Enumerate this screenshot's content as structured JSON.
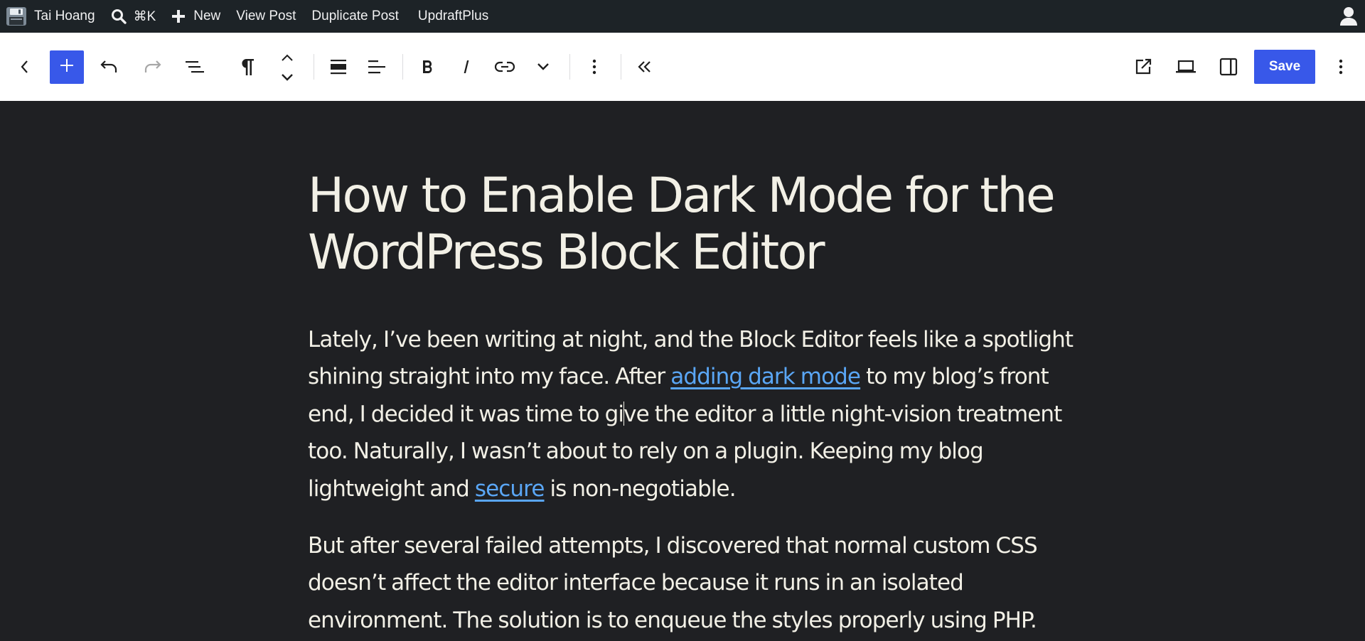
{
  "admin_bar": {
    "site_name": "Tai Hoang",
    "search_shortcut": "⌘K",
    "new_label": "New",
    "view_post": "View Post",
    "duplicate_post": "Duplicate Post",
    "updraftplus": "UpdraftPlus"
  },
  "toolbar": {
    "save_label": "Save",
    "icons": [
      "back-icon",
      "add-block-icon",
      "undo-icon",
      "redo-icon",
      "document-overview-icon",
      "paragraph-icon",
      "move-up-icon",
      "move-down-icon",
      "justify-icon",
      "align-left-icon",
      "bold-icon",
      "italic-icon",
      "link-icon",
      "chevron-down-icon",
      "more-options-icon",
      "collapse-toolbar-icon",
      "external-link-icon",
      "desktop-preview-icon",
      "settings-sidebar-icon",
      "options-icon"
    ]
  },
  "post": {
    "title_line1": "How to Enable Dark Mode for the",
    "title_line2": "WordPress Block Editor",
    "p1": {
      "t1": "Lately, I’ve been writing at night, and the Block Editor feels like a spotlight shining straight into my face. After ",
      "link1": "adding dark mode",
      "t2": " to my blog’s front end, I decided it was time to gi",
      "t3": "ve the editor a little night-vision treatment too. Naturally, I wasn’t about to rely on a plugin. Keeping my blog lightweight and ",
      "link2": "secure",
      "t4": " is non-negotiable."
    },
    "p2": "But after several failed attempts, I discovered that normal custom CSS doesn’t affect the editor interface because it runs in an isolated environment. The solution is to enqueue the styles properly using PHP."
  },
  "colors": {
    "accent": "#3858e9",
    "canvas_bg": "#1f2023",
    "text": "#f2f0e6",
    "link": "#5aa6f5",
    "admin_bar_bg": "#1d2327"
  }
}
